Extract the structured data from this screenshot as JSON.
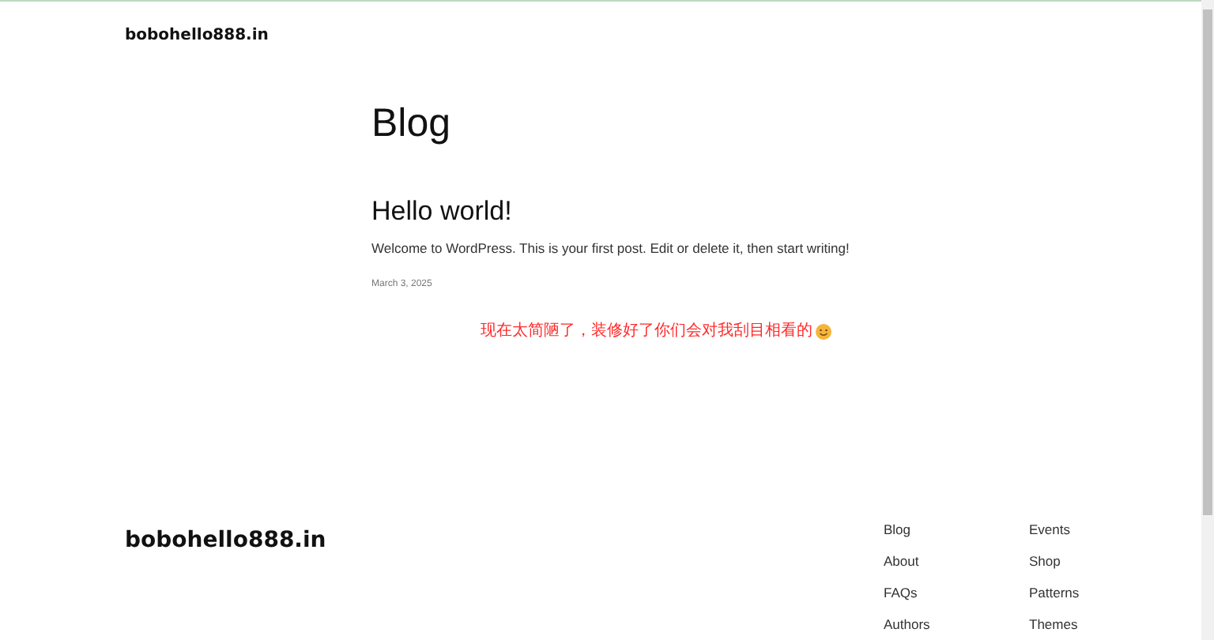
{
  "header": {
    "site_title": "bobohello888.in"
  },
  "page_title": "Blog",
  "posts": [
    {
      "title": "Hello world!",
      "excerpt": "Welcome to WordPress. This is your first post. Edit or delete it, then start writing!",
      "date": "March 3, 2025"
    }
  ],
  "notice": "现在太简陋了，装修好了你们会对我刮目相看的",
  "footer": {
    "site_title": "bobohello888.in",
    "columns": [
      [
        "Blog",
        "About",
        "FAQs",
        "Authors"
      ],
      [
        "Events",
        "Shop",
        "Patterns",
        "Themes"
      ]
    ]
  }
}
